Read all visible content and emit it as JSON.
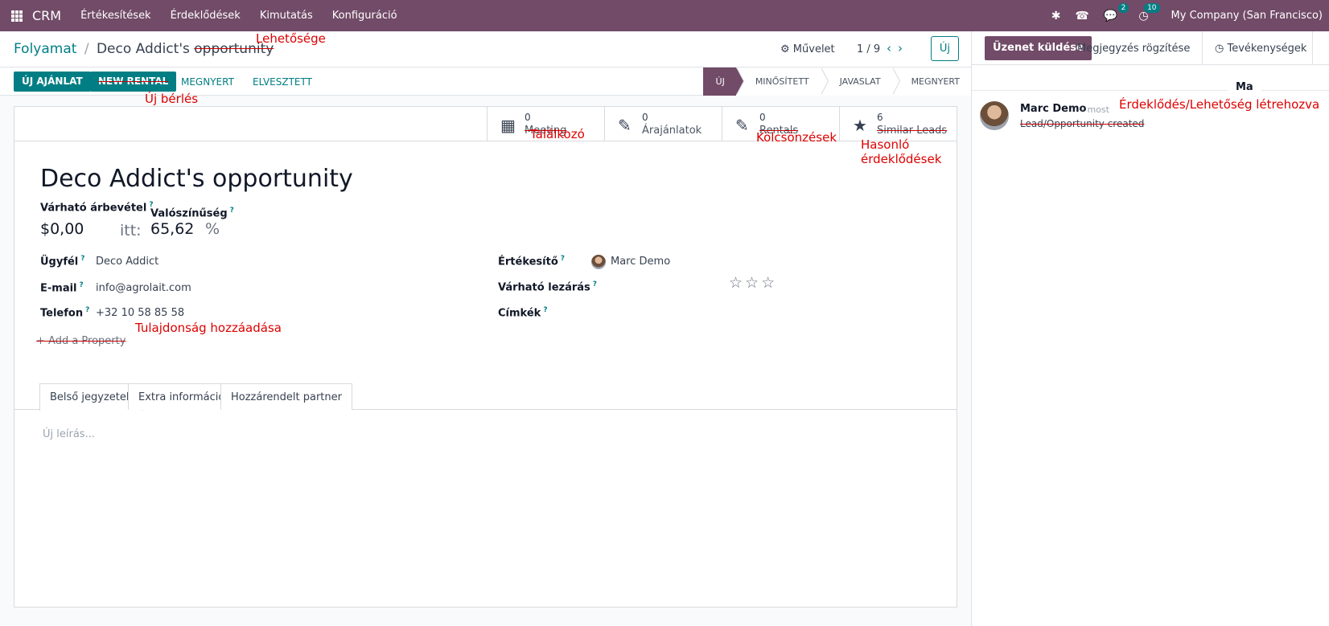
{
  "navbar": {
    "app_name": "CRM",
    "menu": [
      "Értékesítések",
      "Érdeklődések",
      "Kimutatás",
      "Konfiguráció"
    ],
    "chat_badge": "2",
    "activity_badge": "10",
    "company": "My Company (San Francisco)"
  },
  "breadcrumb": {
    "parent": "Folyamat",
    "separator": "/",
    "current_prefix": "Deco Addict's",
    "current_struck": "opportunity",
    "annotation": "Lehetősége"
  },
  "control": {
    "action_label": "Művelet",
    "pager": "1 / 9",
    "new_label": "Új"
  },
  "statusbar": {
    "btn_new_quote": "ÚJ AJÁNLAT",
    "btn_new_rental": "NEW RENTAL",
    "btn_new_rental_annotation": "Új bérlés",
    "btn_won": "MEGNYERT",
    "btn_lost": "ELVESZTETT",
    "stages": [
      "ÚJ",
      "MINŐSÍTETT",
      "JAVASLAT",
      "MEGNYERT"
    ],
    "active_stage": "ÚJ"
  },
  "smart_buttons": [
    {
      "count": "0",
      "label": "Meeting",
      "annotation": "Találkozó"
    },
    {
      "count": "0",
      "label": "Árajánlatok",
      "annotation": ""
    },
    {
      "count": "0",
      "label": "Rentals",
      "annotation": "Kölcsönzések"
    },
    {
      "count": "6",
      "label": "Similar Leads",
      "annotation": "Hasonló érdeklődések"
    }
  ],
  "form": {
    "title": "Deco Addict's opportunity",
    "expected_revenue_label": "Várható árbevétel",
    "expected_revenue_value": "$0,00",
    "at_label": "itt:",
    "probability_label": "Valószínűség",
    "probability_value": "65,62",
    "percent": "%",
    "customer_label": "Ügyfél",
    "customer_value": "Deco Addict",
    "email_label": "E-mail",
    "email_value": "info@agrolait.com",
    "phone_label": "Telefon",
    "phone_value": "+32 10 58 85 58",
    "salesperson_label": "Értékesítő",
    "salesperson_value": "Marc Demo",
    "expected_closing_label": "Várható lezárás",
    "tags_label": "Címkék",
    "priority_stars": "☆☆☆",
    "add_property": "Add a Property",
    "add_property_annotation": "Tulajdonság hozzáadása",
    "tabs": [
      "Belső jegyzetek",
      "Extra információ",
      "Hozzárendelt partner"
    ],
    "description_placeholder": "Új leírás..."
  },
  "chatter": {
    "send_message": "Üzenet küldése",
    "log_note": "Megjegyzés rögzítése",
    "activities": "Tevékenységek",
    "day": "Ma",
    "author": "Marc Demo",
    "time": "- most",
    "body": "Lead/Opportunity created",
    "body_annotation": "Érdeklődés/Lehetőség létrehozva"
  },
  "colors": {
    "brand": "#714b67",
    "accent": "#017e84",
    "annotation": "#dd0000"
  }
}
